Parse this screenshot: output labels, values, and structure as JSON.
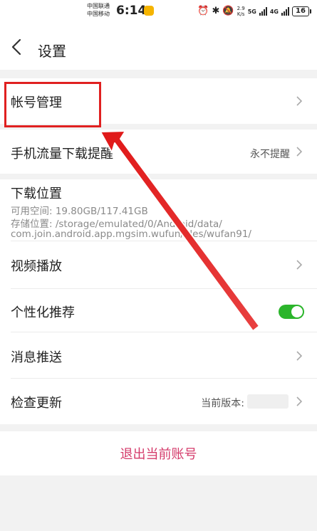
{
  "status_bar": {
    "carrier_1": "中国联通",
    "carrier_2": "中国移动",
    "time": "6:14",
    "net_speed_value": "2.9",
    "net_speed_unit": "K/s",
    "network_1": "5G",
    "network_2": "4G",
    "battery": "16"
  },
  "header": {
    "title": "设置"
  },
  "rows": {
    "account": {
      "label": "帐号管理"
    },
    "data_reminder": {
      "label": "手机流量下载提醒",
      "value": "永不提醒"
    },
    "download_location": {
      "label": "下载位置",
      "space": "可用空间:  19.80GB/117.41GB",
      "path_1": "存储位置:  /storage/emulated/0/Android/data/",
      "path_2": "com.join.android.app.mgsim.wufun/files/wufan91/"
    },
    "video": {
      "label": "视频播放"
    },
    "personalized": {
      "label": "个性化推荐",
      "enabled": true
    },
    "push": {
      "label": "消息推送"
    },
    "update": {
      "label": "检查更新",
      "value": "当前版本:"
    }
  },
  "logout": {
    "label": "退出当前账号"
  },
  "colors": {
    "logout_text": "#d43a6a",
    "toggle_on": "#2bb52b",
    "annotation": "#e02020"
  }
}
